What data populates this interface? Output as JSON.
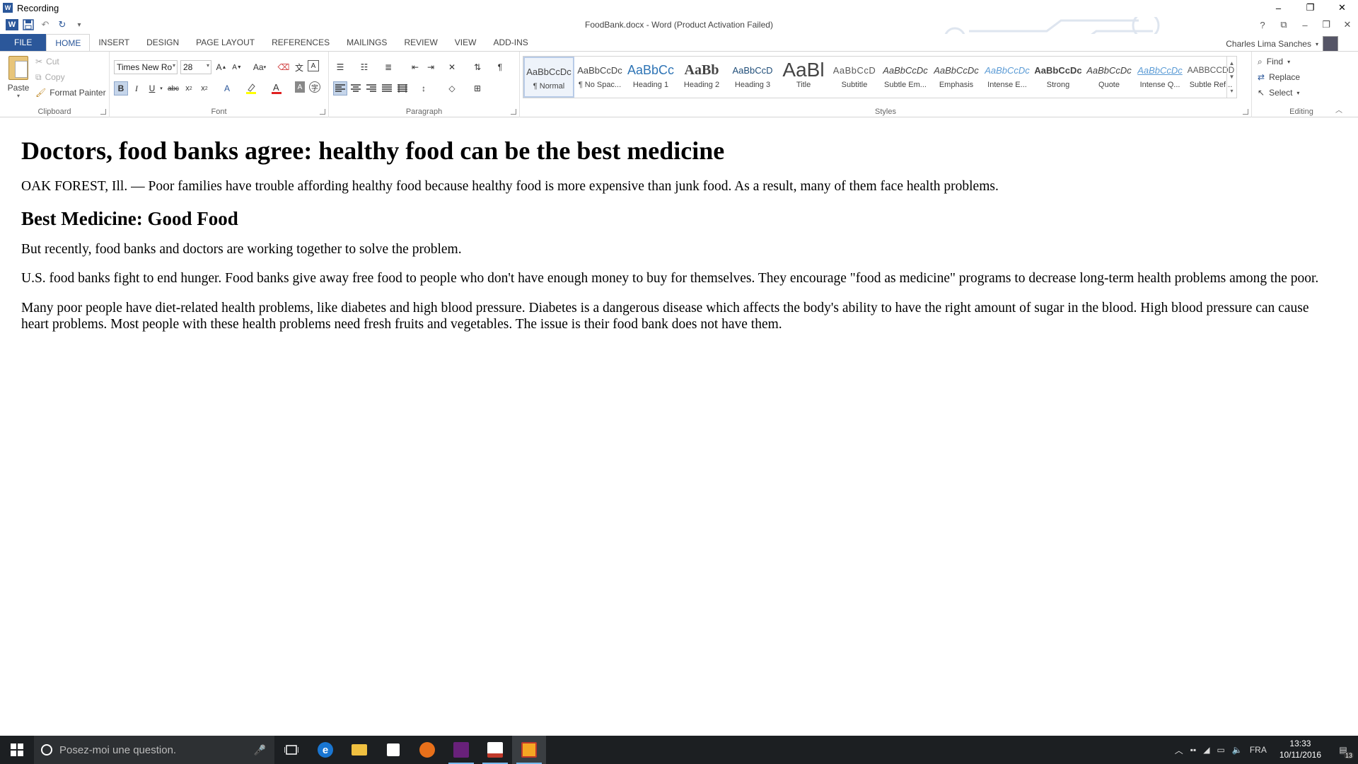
{
  "outer_window": {
    "title": "Recording",
    "minimize": "–",
    "maximize": "❐",
    "close": "✕"
  },
  "word": {
    "doc_title": "FoodBank.docx - Word (Product Activation Failed)",
    "help": "?",
    "ribbon_display": "⧉",
    "minimize": "–",
    "restore": "❐",
    "close": "✕",
    "user_name": "Charles Lima Sanches",
    "qat": {
      "undo": "↶",
      "redo": "↻",
      "customize": "▾"
    }
  },
  "tabs": [
    "FILE",
    "HOME",
    "INSERT",
    "DESIGN",
    "PAGE LAYOUT",
    "REFERENCES",
    "MAILINGS",
    "REVIEW",
    "VIEW",
    "ADD-INS"
  ],
  "ribbon": {
    "clipboard": {
      "label": "Clipboard",
      "paste": "Paste",
      "cut": "Cut",
      "copy": "Copy",
      "format_painter": "Format Painter"
    },
    "font": {
      "label": "Font",
      "font_name": "Times New Ro",
      "font_size": "28",
      "change_case": "Aa"
    },
    "paragraph": {
      "label": "Paragraph"
    },
    "styles": {
      "label": "Styles",
      "items": [
        {
          "preview": "AaBbCcDc",
          "name": "¶ Normal",
          "color": "#000000"
        },
        {
          "preview": "AaBbCcDc",
          "name": "¶ No Spac...",
          "color": "#000000"
        },
        {
          "preview": "AaBbCc",
          "name": "Heading 1",
          "color": "#2e74b5"
        },
        {
          "preview": "AaBb",
          "name": "Heading 2",
          "color": "#000000"
        },
        {
          "preview": "AaBbCcD",
          "name": "Heading 3",
          "color": "#1f4d78"
        },
        {
          "preview": "AaBl",
          "name": "Title",
          "color": "#000000"
        },
        {
          "preview": "AaBbCcD",
          "name": "Subtitle",
          "color": "#5a5a5a"
        },
        {
          "preview": "AaBbCcDc",
          "name": "Subtle Em...",
          "color": "#404040"
        },
        {
          "preview": "AaBbCcDc",
          "name": "Emphasis",
          "color": "#000000"
        },
        {
          "preview": "AaBbCcDc",
          "name": "Intense E...",
          "color": "#5b9bd5"
        },
        {
          "preview": "AaBbCcDc",
          "name": "Strong",
          "color": "#000000"
        },
        {
          "preview": "AaBbCcDc",
          "name": "Quote",
          "color": "#404040"
        },
        {
          "preview": "AaBbCcDc",
          "name": "Intense Q...",
          "color": "#5b9bd5"
        },
        {
          "preview": "AABBCCDD",
          "name": "Subtle Ref...",
          "color": "#5a5a5a"
        }
      ]
    },
    "editing": {
      "label": "Editing",
      "find": "Find",
      "replace": "Replace",
      "select": "Select"
    }
  },
  "document": {
    "title": "Doctors, food banks agree: healthy food can be the best medicine",
    "p1": "OAK FOREST, Ill. — Poor families have trouble affording healthy food because healthy food is more expensive than junk food. As a result, many of them face health problems.",
    "h2": "Best Medicine: Good Food",
    "p2": "But recently, food banks and doctors are working together to solve the problem.",
    "p3": "U.S. food banks fight to end hunger. Food banks give away free food to people who don't have enough money to buy for themselves. They encourage \"food as medicine\" programs to decrease long-term health problems among the poor.",
    "p4": "Many poor people have diet-related health problems, like diabetes and high blood pressure. Diabetes is a dangerous disease which affects the body's ability to have the right amount of sugar in the blood. High blood pressure can cause heart problems. Most people with these health problems need fresh fruits and vegetables. The issue is their food bank does not have them."
  },
  "taskbar": {
    "search_placeholder": "Posez-moi une question.",
    "language": "FRA",
    "time": "13:33",
    "date": "10/11/2016",
    "notification_count": "13"
  },
  "colors": {
    "word_blue": "#2b579a",
    "taskbar": "#1c1f22"
  }
}
